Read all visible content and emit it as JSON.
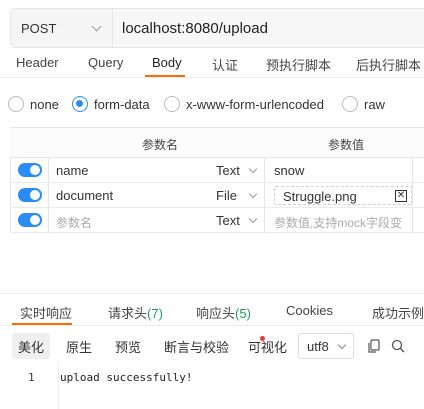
{
  "request": {
    "method": "POST",
    "url": "localhost:8080/upload"
  },
  "request_tabs": [
    {
      "label": "Header",
      "active": false
    },
    {
      "label": "Query",
      "active": false
    },
    {
      "label": "Body",
      "active": true
    },
    {
      "label": "认证",
      "active": false
    },
    {
      "label": "预执行脚本",
      "active": false
    },
    {
      "label": "后执行脚本",
      "active": false
    }
  ],
  "body_types": [
    {
      "label": "none",
      "checked": false
    },
    {
      "label": "form-data",
      "checked": true
    },
    {
      "label": "x-www-form-urlencoded",
      "checked": false
    },
    {
      "label": "raw",
      "checked": false
    }
  ],
  "params_table": {
    "headers": {
      "name": "参数名",
      "value": "参数值"
    },
    "rows": [
      {
        "enabled": true,
        "name": "name",
        "type": "Text",
        "value": "snow"
      },
      {
        "enabled": true,
        "name": "document",
        "type": "File",
        "value": "Struggle.png"
      },
      {
        "enabled": true,
        "name_placeholder": "参数名",
        "type": "Text",
        "value_placeholder": "参数值,支持mock字段变"
      }
    ]
  },
  "response_tabs": [
    {
      "label": "实时响应",
      "active": true
    },
    {
      "label": "请求头",
      "count": "(7)"
    },
    {
      "label": "响应头",
      "count": "(5)"
    },
    {
      "label": "Cookies"
    },
    {
      "label": "成功示例"
    }
  ],
  "response_toolbar": {
    "formats": [
      "美化",
      "原生",
      "预览",
      "断言与校验",
      "可视化"
    ],
    "active_format": "美化",
    "encoding": "utf8",
    "icons": [
      "copy-icon",
      "search-icon"
    ]
  },
  "response_body": {
    "line_number": "1",
    "text": "upload successfully!"
  },
  "colors": {
    "accent": "#ff6a00",
    "primary": "#2b8cf5",
    "count_green": "#1aa052",
    "dot_red": "#e53935"
  }
}
